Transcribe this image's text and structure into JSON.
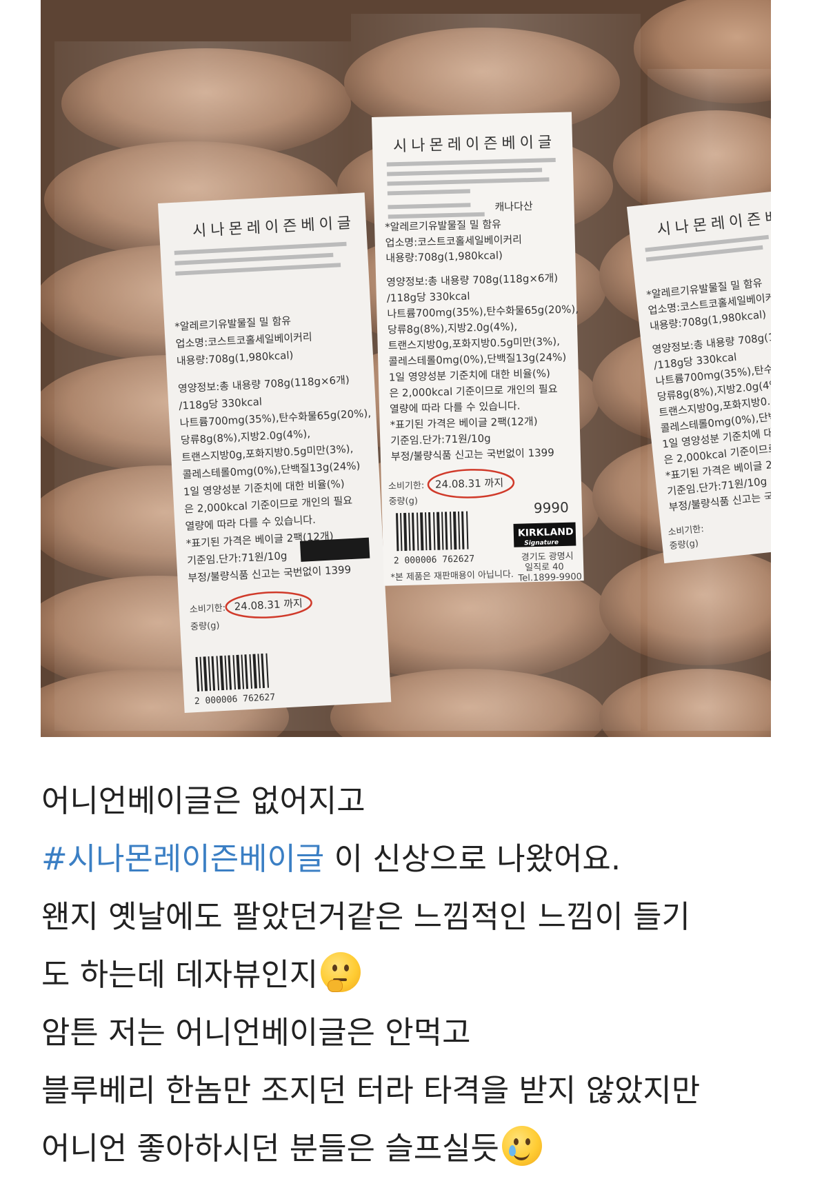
{
  "photo": {
    "alt_icon": "bagel-product-photo",
    "label_center": {
      "title": "시나몬레이즌베이글",
      "origin": "캐나다산",
      "section_title": "*알레르기유발물질 밀 함유",
      "seller": "업소명:코스트코홀세일베이커리",
      "volume": "내용량:708g(1,980kcal)",
      "nutrition_1": "영양정보:총 내용량 708g(118g×6개)",
      "nutrition_2": "/118g당 330kcal",
      "nutrition_3": "나트륨700mg(35%),탄수화물65g(20%),",
      "nutrition_4": "당류8g(8%),지방2.0g(4%),",
      "nutrition_5": "트랜스지방0g,포화지방0.5g미만(3%),",
      "nutrition_6": "콜레스테롤0mg(0%),단백질13g(24%)",
      "nutrition_7": "1일 영양성분 기준치에 대한 비율(%)",
      "nutrition_8": "은 2,000kcal 기준이므로 개인의 필요",
      "nutrition_9": "열량에 따라 다를 수 있습니다.",
      "nutrition_10": "*표기된 가격은 베이글 2팩(12개)",
      "nutrition_11": "기준임.단가:71원/10g",
      "nutrition_12": "부정/불량식품 신고는 국번없이 1399",
      "expiry_label": "소비기한:",
      "expiry_date": "24.08.31 까지",
      "weight_label": "중량(g)",
      "price": "9990",
      "barcode_number": "2 000006 762627",
      "brand": "KIRKLAND",
      "brand_sub": "Signature",
      "address_1": "경기도 광명시",
      "address_2": "일직로 40",
      "tel": "Tel.1899-9900",
      "footer": "*본 제품은 재판매용이 아닙니다."
    }
  },
  "post": {
    "line1": "어니언베이글은 없어지고",
    "hashtag": "#시나몬레이즌베이글",
    "line2_rest": " 이 신상으로 나왔어요.",
    "line3": "왠지 옛날에도 팔았던거같은 느낌적인 느낌이 들기",
    "line4": "도 하는데 데자뷰인지",
    "line5": "암튼 저는 어니언베이글은 안먹고",
    "line6": "블루베리 한놈만 조지던 터라 타격을 받지 않았지만",
    "line7": "어니언 좋아하시던 분들은 슬프실듯",
    "emoji_1": "thinking-face",
    "emoji_2": "smiling-face-with-tear"
  }
}
